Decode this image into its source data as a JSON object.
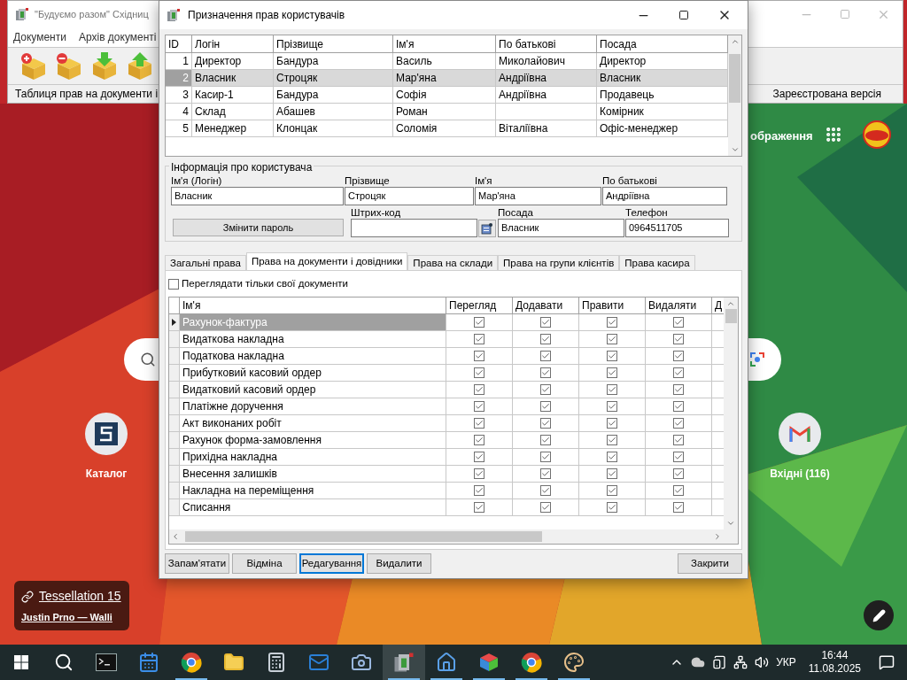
{
  "desktop": {
    "partial_label": "ображення",
    "shortcuts": [
      {
        "kind": "catalog",
        "label": "Каталог"
      },
      {
        "kind": "mail",
        "label": "Вхідні (116)"
      }
    ],
    "wallpaper": {
      "title": "Tessellation 15",
      "author": "Justin Prno — Walli"
    }
  },
  "background_window": {
    "title": "\"Будуємо разом\" Східниц",
    "menu": [
      "Документи",
      "Архів документі"
    ],
    "toolbar": [
      {
        "kind": "add"
      },
      {
        "kind": "remove"
      },
      {
        "kind": "import"
      },
      {
        "kind": "export"
      }
    ],
    "status": [
      "Таблиця прав на документи і",
      "Зареєстрована версія"
    ]
  },
  "dialog": {
    "title": "Призначення прав користувачів",
    "users": {
      "columns": [
        "ID",
        "Логін",
        "Прізвище",
        "Ім'я",
        "По батькові",
        "Посада"
      ],
      "rows": [
        {
          "selected": false,
          "id": "1",
          "login": "Директор",
          "surname": "Бандура",
          "name": "Василь",
          "patronymic": "Миколайович",
          "position": "Директор"
        },
        {
          "selected": true,
          "id": "2",
          "login": "Власник",
          "surname": "Строцяк",
          "name": "Мар'яна",
          "patronymic": "Андріївна",
          "position": "Власник"
        },
        {
          "selected": false,
          "id": "3",
          "login": "Касир-1",
          "surname": "Бандура",
          "name": "Софія",
          "patronymic": "Андріївна",
          "position": "Продавець"
        },
        {
          "selected": false,
          "id": "4",
          "login": "Склад",
          "surname": "Абашев",
          "name": "Роман",
          "position": "Комірник"
        },
        {
          "selected": false,
          "id": "5",
          "login": "Менеджер",
          "surname": "Клонцак",
          "name": "Соломія",
          "patronymic": "Віталіївна",
          "position": "Офіс-менеджер"
        }
      ]
    },
    "user_info": {
      "title": "Інформація про користувача",
      "fields": [
        {
          "label": "Ім'я (Логін)",
          "value": "Власник"
        },
        {
          "label": "Прізвище",
          "value": "Строцяк"
        },
        {
          "label": "Ім'я",
          "value": "Мар'яна"
        },
        {
          "label": "По батькові",
          "value": "Андріївна"
        }
      ],
      "change_password": "Змінити пароль",
      "barcode": {
        "label": "Штрих-код"
      },
      "position": {
        "label": "Посада",
        "value": "Власник"
      },
      "phone": {
        "label": "Телефон",
        "value": "0964511705"
      }
    },
    "tabs": [
      {
        "label": "Загальні права",
        "selected": false
      },
      {
        "label": "Права на документи і довідники",
        "selected": true
      },
      {
        "label": "Права на склади",
        "selected": false
      },
      {
        "label": "Права на групи клієнтів",
        "selected": false
      },
      {
        "label": "Права касира",
        "selected": false
      }
    ],
    "own_documents_only": {
      "label": "Переглядати тільки свої документи",
      "checked": false
    },
    "rights": {
      "columns": [
        "Ім'я",
        "Перегляд",
        "Додавати",
        "Правити",
        "Видаляти",
        "Д"
      ],
      "rows": [
        {
          "name": "Рахунок-фактура",
          "selected": true,
          "checks": [
            true,
            true,
            true,
            true
          ]
        },
        {
          "name": "Видаткова накладна",
          "selected": false,
          "checks": [
            true,
            true,
            true,
            true
          ]
        },
        {
          "name": "Податкова накладна",
          "selected": false,
          "checks": [
            true,
            true,
            true,
            true
          ]
        },
        {
          "name": "Прибутковий касовий ордер",
          "selected": false,
          "checks": [
            true,
            true,
            true,
            true
          ]
        },
        {
          "name": "Видатковий касовий ордер",
          "selected": false,
          "checks": [
            true,
            true,
            true,
            true
          ]
        },
        {
          "name": "Платіжне доручення",
          "selected": false,
          "checks": [
            true,
            true,
            true,
            true
          ]
        },
        {
          "name": "Акт виконаних робіт",
          "selected": false,
          "checks": [
            true,
            true,
            true,
            true
          ]
        },
        {
          "name": "Рахунок форма-замовлення",
          "selected": false,
          "checks": [
            true,
            true,
            true,
            true
          ]
        },
        {
          "name": "Прихідна накладна",
          "selected": false,
          "checks": [
            true,
            true,
            true,
            true
          ]
        },
        {
          "name": "Внесення залишків",
          "selected": false,
          "checks": [
            true,
            true,
            true,
            true
          ]
        },
        {
          "name": "Накладна на переміщення",
          "selected": false,
          "checks": [
            true,
            true,
            true,
            true
          ]
        },
        {
          "name": "Списання",
          "selected": false,
          "checks": [
            true,
            true,
            true,
            true
          ]
        }
      ]
    },
    "buttons": [
      {
        "label": "Запам'ятати",
        "focused": false
      },
      {
        "label": "Відміна",
        "focused": false
      },
      {
        "label": "Редагування",
        "focused": true
      },
      {
        "label": "Видалити",
        "focused": false
      }
    ],
    "close_button": "Закрити"
  },
  "taskbar": {
    "apps": [
      {
        "kind": "terminal",
        "running": false,
        "active": false
      },
      {
        "kind": "calendar",
        "running": false,
        "active": false
      },
      {
        "kind": "browser",
        "running": true,
        "active": false
      },
      {
        "kind": "folder",
        "running": false,
        "active": false
      },
      {
        "kind": "calculator",
        "running": false,
        "active": false
      },
      {
        "kind": "mail",
        "running": false,
        "active": false
      },
      {
        "kind": "camera",
        "running": false,
        "active": false
      },
      {
        "kind": "app",
        "running": true,
        "active": true
      },
      {
        "kind": "home",
        "running": true,
        "active": false
      },
      {
        "kind": "cube",
        "running": true,
        "active": false
      },
      {
        "kind": "browser",
        "running": true,
        "active": false
      },
      {
        "kind": "paint",
        "running": true,
        "active": false
      }
    ],
    "language": "УКР",
    "time": "16:44",
    "date": "11.08.2025"
  }
}
